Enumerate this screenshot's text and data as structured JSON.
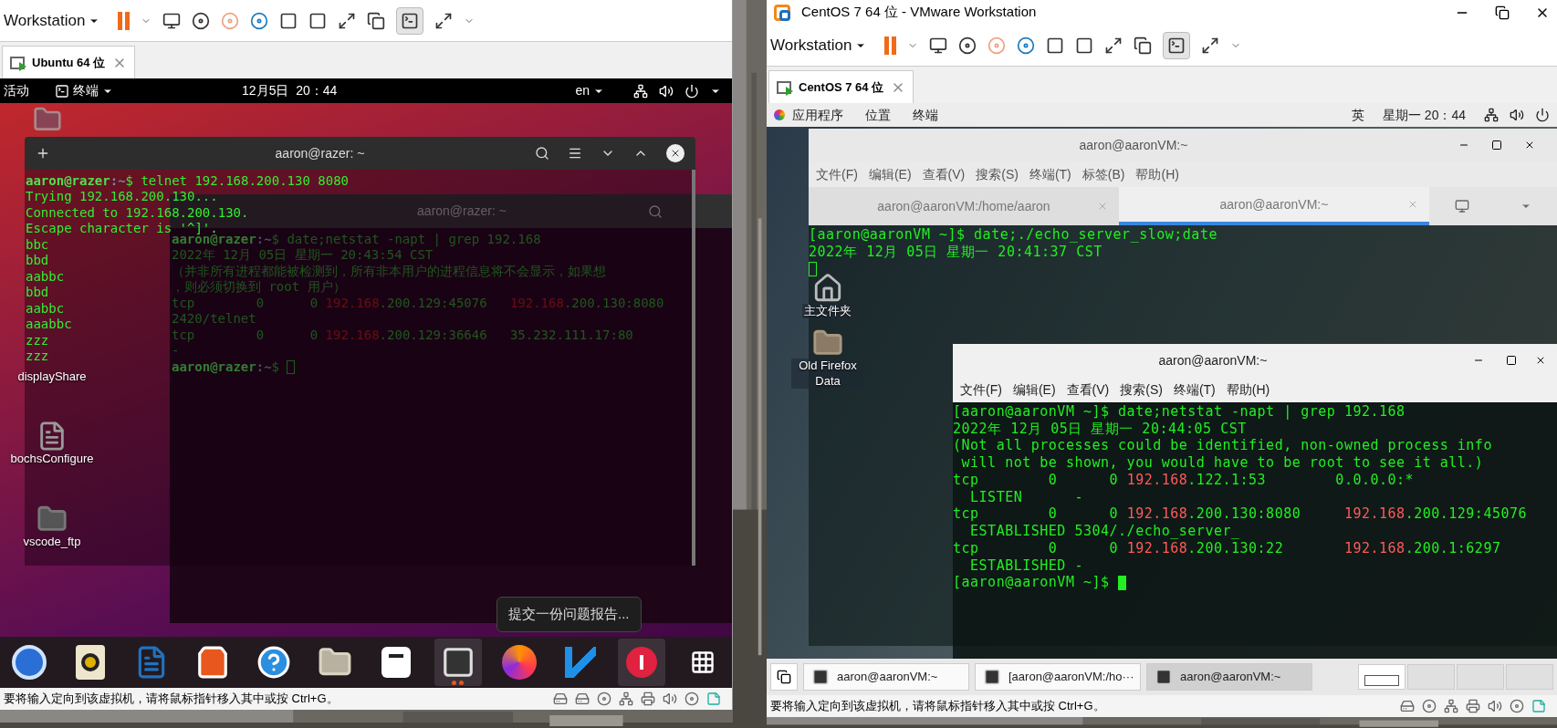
{
  "left_window": {
    "toolbar": {
      "menu": "Workstation"
    },
    "tab": {
      "label": "Ubuntu 64 位"
    },
    "ubuntu": {
      "activities": "活动",
      "app_menu": "终端",
      "clock": "12月5日  20：44",
      "keyboard": "en",
      "desktop_icons": [
        {
          "label": "displayShare",
          "kind": "label-only"
        },
        {
          "label": "bochsConfigure",
          "kind": "file"
        },
        {
          "label": "vscode_ftp",
          "kind": "folder"
        }
      ],
      "back_terminal": {
        "title": "aaron@razer: ~",
        "lines": [
          [
            {
              "text": "aaron@razer",
              "kind": "user"
            },
            {
              "text": ":~",
              "kind": "path"
            },
            {
              "text": "$ date;netstat -napt | grep 192.168",
              "kind": "plain"
            }
          ],
          [
            {
              "text": "2022年 12月 05日 星期一 20:43:54 CST",
              "kind": "plain"
            }
          ],
          [
            {
              "text": "（并非所有进程都能被检测到，所有非本用户的进程信息将不会显示，如果想",
              "kind": "plain"
            }
          ],
          [
            {
              "text": "，则必须切换到 root 用户）",
              "kind": "plain"
            }
          ],
          [
            {
              "text": "tcp        0      0 ",
              "kind": "plain"
            },
            {
              "text": "192.168",
              "kind": "ip"
            },
            {
              "text": ".200.129:45076   ",
              "kind": "plain"
            },
            {
              "text": "192.168",
              "kind": "ip"
            },
            {
              "text": ".200.130:8080",
              "kind": "plain"
            }
          ],
          [
            {
              "text": "2420/telnet",
              "kind": "plain"
            }
          ],
          [
            {
              "text": "tcp        0      0 ",
              "kind": "plain"
            },
            {
              "text": "192.168",
              "kind": "ip"
            },
            {
              "text": ".200.129:36646   35.232.111.17:80",
              "kind": "plain"
            }
          ],
          [
            {
              "text": "-",
              "kind": "plain"
            }
          ],
          [
            {
              "text": "aaron@razer",
              "kind": "user"
            },
            {
              "text": ":~",
              "kind": "path"
            },
            {
              "text": "$ ",
              "kind": "plain"
            },
            {
              "kind": "cursor"
            }
          ]
        ]
      },
      "front_terminal": {
        "title": "aaron@razer: ~",
        "lines": [
          [
            {
              "text": "aaron@razer",
              "kind": "user"
            },
            {
              "text": ":~",
              "kind": "path"
            },
            {
              "text": "$ telnet 192.168.200.130 8080",
              "kind": "plain"
            }
          ],
          [
            {
              "text": "Trying 192.168.200.130...",
              "kind": "plain"
            }
          ],
          [
            {
              "text": "Connected to 192.168.200.130.",
              "kind": "plain"
            }
          ],
          [
            {
              "text": "Escape character is '^]'.",
              "kind": "plain"
            }
          ],
          [
            {
              "text": "bbc",
              "kind": "plain"
            }
          ],
          [
            {
              "text": "bbd",
              "kind": "plain"
            }
          ],
          [
            {
              "text": "aabbc",
              "kind": "plain"
            }
          ],
          [
            {
              "text": "bbd",
              "kind": "plain"
            }
          ],
          [
            {
              "text": "aabbc",
              "kind": "plain"
            }
          ],
          [
            {
              "text": "aaabbc",
              "kind": "plain"
            }
          ],
          [
            {
              "text": "zzz",
              "kind": "plain"
            }
          ],
          [
            {
              "text": "zzz",
              "kind": "plain"
            }
          ]
        ]
      },
      "tooltip": "提交一份问题报告...",
      "dock": [
        {
          "kind": "mail",
          "selected": false
        },
        {
          "kind": "music",
          "selected": false
        },
        {
          "kind": "writer",
          "selected": false
        },
        {
          "kind": "store",
          "selected": false
        },
        {
          "kind": "help",
          "selected": false
        },
        {
          "kind": "files",
          "selected": false
        },
        {
          "kind": "typora",
          "selected": false
        },
        {
          "kind": "terminal",
          "selected": true
        },
        {
          "kind": "firefox",
          "selected": false
        },
        {
          "kind": "code",
          "selected": false
        },
        {
          "kind": "error",
          "selected": true
        },
        {
          "kind": "apps",
          "selected": false
        }
      ]
    },
    "status_bar": "要将输入定向到该虚拟机，请将鼠标指针移入其中或按 Ctrl+G。"
  },
  "right_window": {
    "title": "CentOS 7 64 位 - VMware Workstation",
    "toolbar": {
      "menu": "Workstation"
    },
    "tab": {
      "label": "CentOS 7 64 位"
    },
    "centos": {
      "menus": [
        "应用程序",
        "位置",
        "终端"
      ],
      "input_method": "英",
      "clock": "星期一 20：44",
      "desktop_icons": [
        {
          "label": "主文件夹",
          "kind": "home"
        },
        {
          "label": "Old Firefox Data",
          "kind": "folder"
        }
      ],
      "back_terminal": {
        "title": "aaron@aaronVM:~",
        "menus": [
          "文件(F)",
          "编辑(E)",
          "查看(V)",
          "搜索(S)",
          "终端(T)",
          "标签(B)",
          "帮助(H)"
        ],
        "tabs": [
          {
            "label": "aaron@aaronVM:/home/aaron",
            "selected": false
          },
          {
            "label": "aaron@aaronVM:~",
            "selected": true
          }
        ],
        "lines": [
          [
            {
              "text": "[aaron@aaronVM ~]$ date;./echo_server_slow;date",
              "kind": "plain"
            }
          ],
          [
            {
              "text": "2022年 12月 05日 星期一 20:41:37 CST",
              "kind": "plain"
            }
          ],
          [
            {
              "kind": "cursor-hollow"
            }
          ]
        ]
      },
      "front_terminal": {
        "title": "aaron@aaronVM:~",
        "menus": [
          "文件(F)",
          "编辑(E)",
          "查看(V)",
          "搜索(S)",
          "终端(T)",
          "帮助(H)"
        ],
        "lines": [
          [
            {
              "text": "[aaron@aaronVM ~]$ date;netstat -napt | grep 192.168",
              "kind": "plain"
            }
          ],
          [
            {
              "text": "2022年 12月 05日 星期一 20:44:05 CST",
              "kind": "plain"
            }
          ],
          [
            {
              "text": "(Not all processes could be identified, non-owned process info",
              "kind": "plain"
            }
          ],
          [
            {
              "text": " will not be shown, you would have to be root to see it all.)",
              "kind": "plain"
            }
          ],
          [
            {
              "text": "tcp        0      0 ",
              "kind": "plain"
            },
            {
              "text": "192.168",
              "kind": "ip"
            },
            {
              "text": ".122.1:53        0.0.0.0:*",
              "kind": "plain"
            }
          ],
          [
            {
              "text": "  LISTEN      -",
              "kind": "plain"
            }
          ],
          [
            {
              "text": "tcp        0      0 ",
              "kind": "plain"
            },
            {
              "text": "192.168",
              "kind": "ip"
            },
            {
              "text": ".200.130:8080     ",
              "kind": "plain"
            },
            {
              "text": "192.168",
              "kind": "ip"
            },
            {
              "text": ".200.129:45076",
              "kind": "plain"
            }
          ],
          [
            {
              "text": "  ESTABLISHED 5304/./echo_server_",
              "kind": "plain"
            }
          ],
          [
            {
              "text": "tcp        0      0 ",
              "kind": "plain"
            },
            {
              "text": "192.168",
              "kind": "ip"
            },
            {
              "text": ".200.130:22       ",
              "kind": "plain"
            },
            {
              "text": "192.168",
              "kind": "ip"
            },
            {
              "text": ".200.1:6297",
              "kind": "plain"
            }
          ],
          [
            {
              "text": "  ESTABLISHED -",
              "kind": "plain"
            }
          ],
          [
            {
              "text": "[aaron@aaronVM ~]$ ",
              "kind": "plain"
            },
            {
              "kind": "cursor"
            }
          ]
        ]
      },
      "taskbar": [
        {
          "label": "aaron@aaronVM:~",
          "selected": false
        },
        {
          "label": "[aaron@aaronVM:/ho···",
          "selected": false
        },
        {
          "label": "aaron@aaronVM:~",
          "selected": true
        }
      ],
      "workspaces": [
        {
          "selected": true
        },
        {
          "selected": false
        },
        {
          "selected": false
        },
        {
          "selected": false
        }
      ]
    },
    "status_bar": "要将输入定向到该虚拟机，请将鼠标指针移入其中或按 Ctrl+G。"
  }
}
